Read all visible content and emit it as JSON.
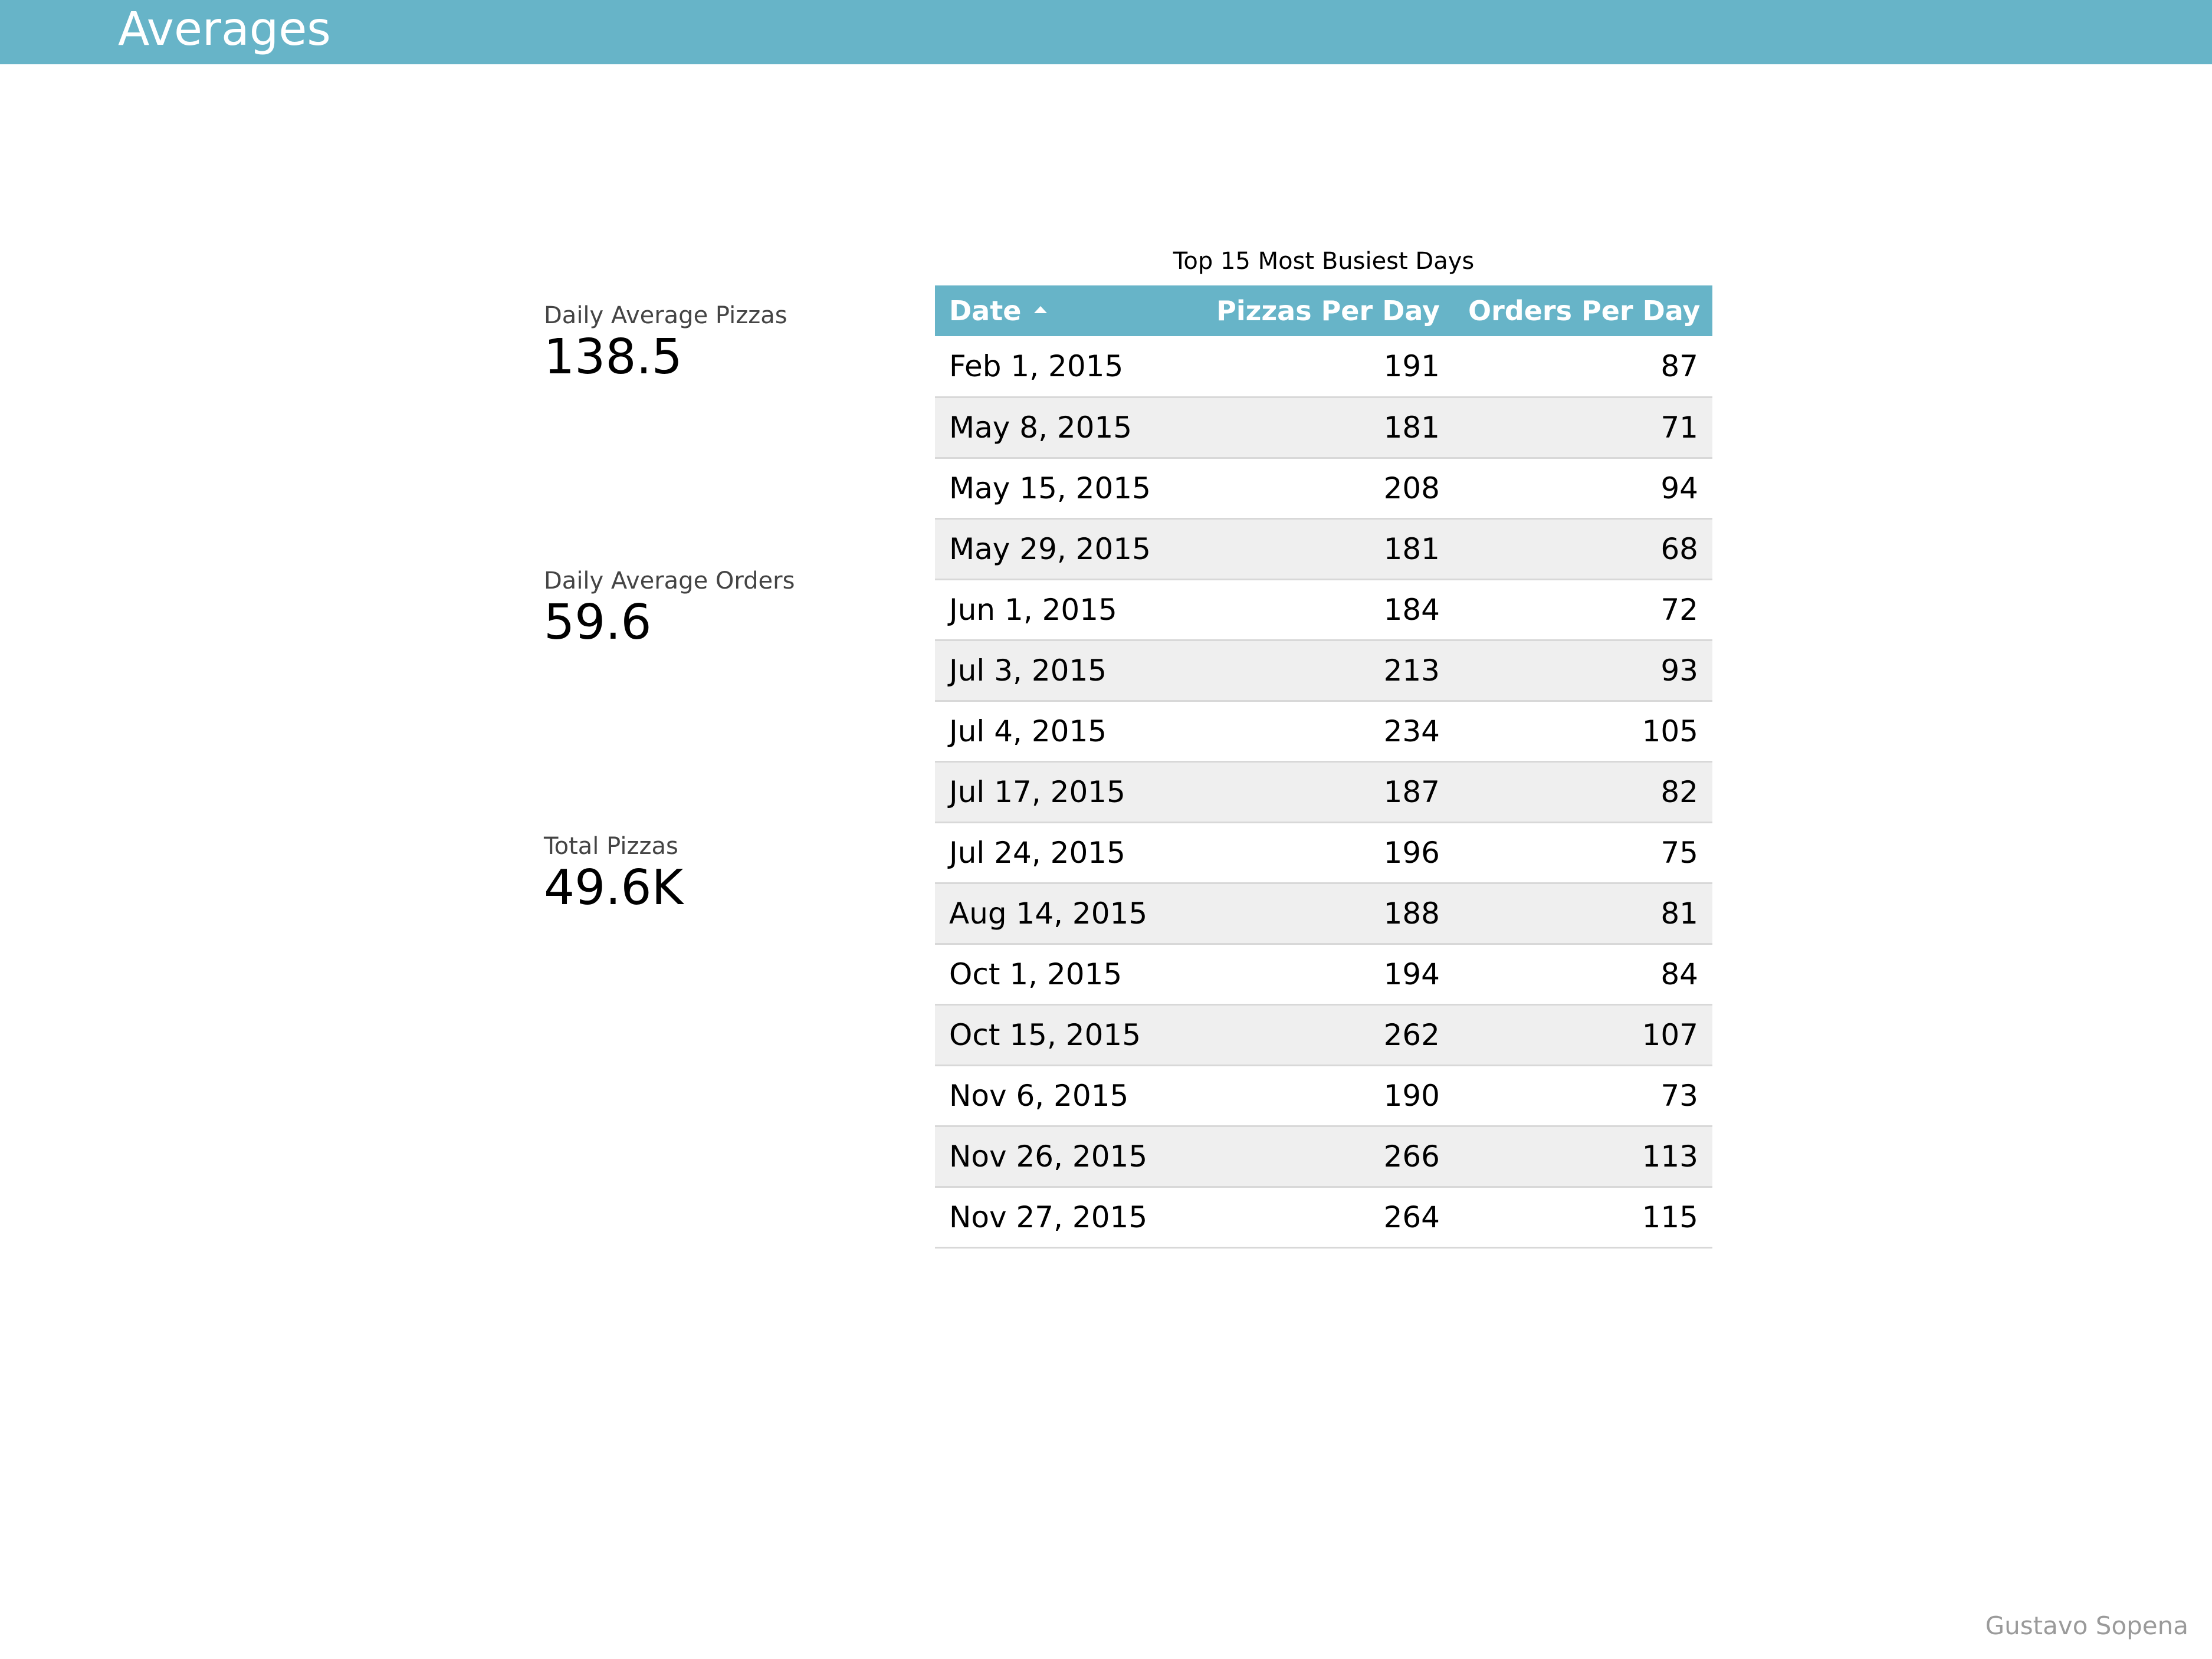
{
  "header": {
    "title": "Averages"
  },
  "scorecards": [
    {
      "label": "Daily Average Pizzas",
      "value": "138.5"
    },
    {
      "label": "Daily Average Orders",
      "value": "59.6"
    },
    {
      "label": "Total Pizzas",
      "value": "49.6K"
    }
  ],
  "table": {
    "title": "Top 15 Most Busiest Days",
    "columns": [
      "Date",
      "Pizzas Per Day",
      "Orders Per Day"
    ],
    "sort": {
      "column": "Date",
      "direction": "ascending"
    },
    "rows": [
      {
        "date": "Feb 1, 2015",
        "pizzas": "191",
        "orders": "87"
      },
      {
        "date": "May 8, 2015",
        "pizzas": "181",
        "orders": "71"
      },
      {
        "date": "May 15, 2015",
        "pizzas": "208",
        "orders": "94"
      },
      {
        "date": "May 29, 2015",
        "pizzas": "181",
        "orders": "68"
      },
      {
        "date": "Jun 1, 2015",
        "pizzas": "184",
        "orders": "72"
      },
      {
        "date": "Jul 3, 2015",
        "pizzas": "213",
        "orders": "93"
      },
      {
        "date": "Jul 4, 2015",
        "pizzas": "234",
        "orders": "105"
      },
      {
        "date": "Jul 17, 2015",
        "pizzas": "187",
        "orders": "82"
      },
      {
        "date": "Jul 24, 2015",
        "pizzas": "196",
        "orders": "75"
      },
      {
        "date": "Aug 14, 2015",
        "pizzas": "188",
        "orders": "81"
      },
      {
        "date": "Oct 1, 2015",
        "pizzas": "194",
        "orders": "84"
      },
      {
        "date": "Oct 15, 2015",
        "pizzas": "262",
        "orders": "107"
      },
      {
        "date": "Nov 6, 2015",
        "pizzas": "190",
        "orders": "73"
      },
      {
        "date": "Nov 26, 2015",
        "pizzas": "266",
        "orders": "113"
      },
      {
        "date": "Nov 27, 2015",
        "pizzas": "264",
        "orders": "115"
      }
    ]
  },
  "footer": {
    "author": "Gustavo Sopena"
  },
  "colors": {
    "header_bar": "#67b4c8",
    "row_alt": "#efefef",
    "label_text": "#444444",
    "footer_text": "#9a9a9a"
  },
  "icons": {
    "sort": "sort-ascending-icon"
  }
}
